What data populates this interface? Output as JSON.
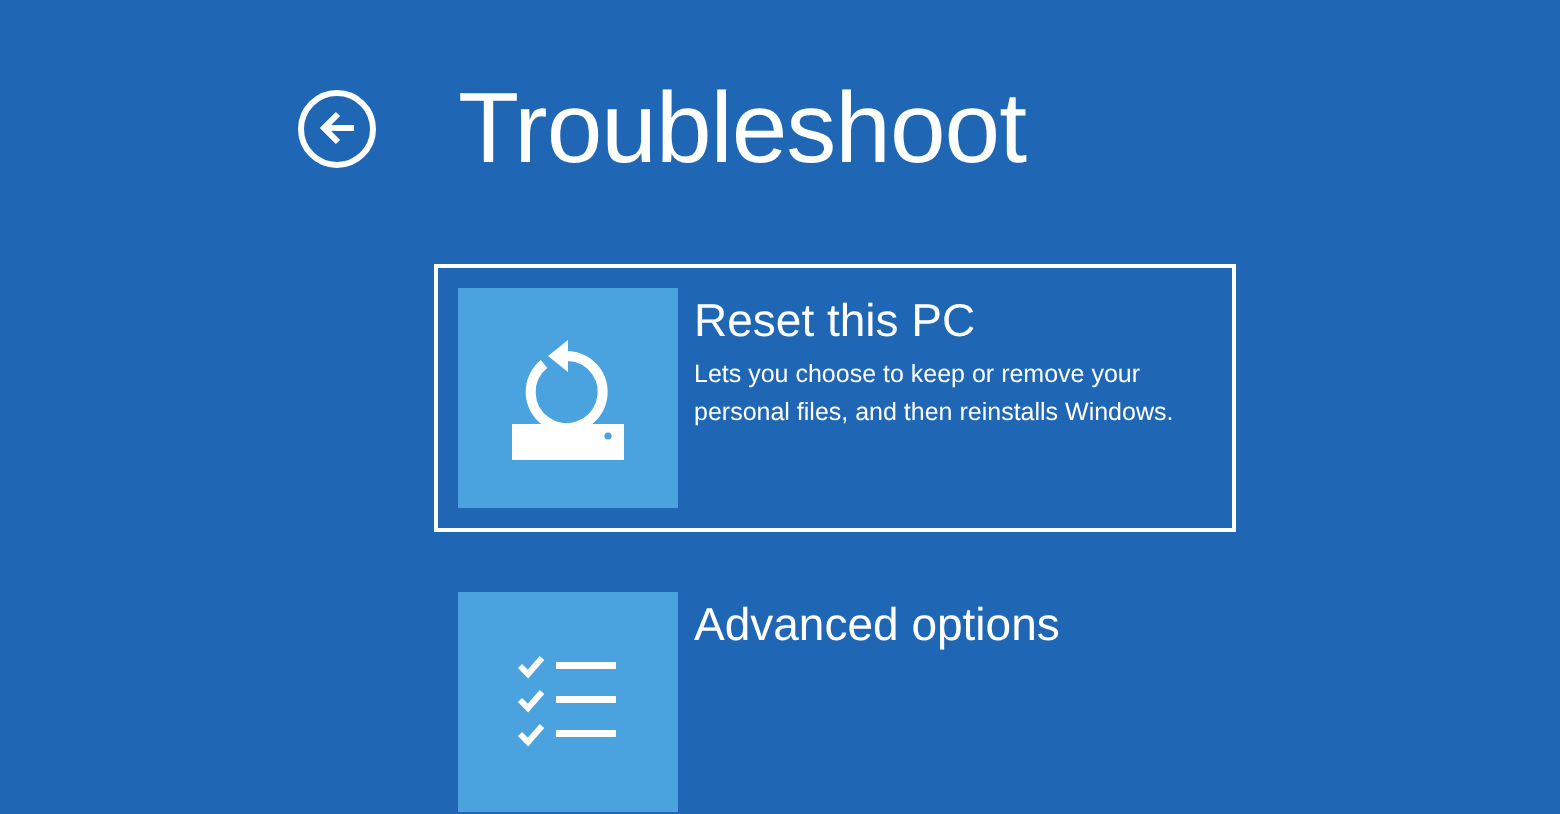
{
  "header": {
    "title": "Troubleshoot"
  },
  "options": [
    {
      "kind": "reset",
      "title": "Reset this PC",
      "description": "Lets you choose to keep or remove your personal files, and then reinstalls Windows.",
      "selected": true
    },
    {
      "kind": "checklist",
      "title": "Advanced options",
      "selected": false
    }
  ]
}
